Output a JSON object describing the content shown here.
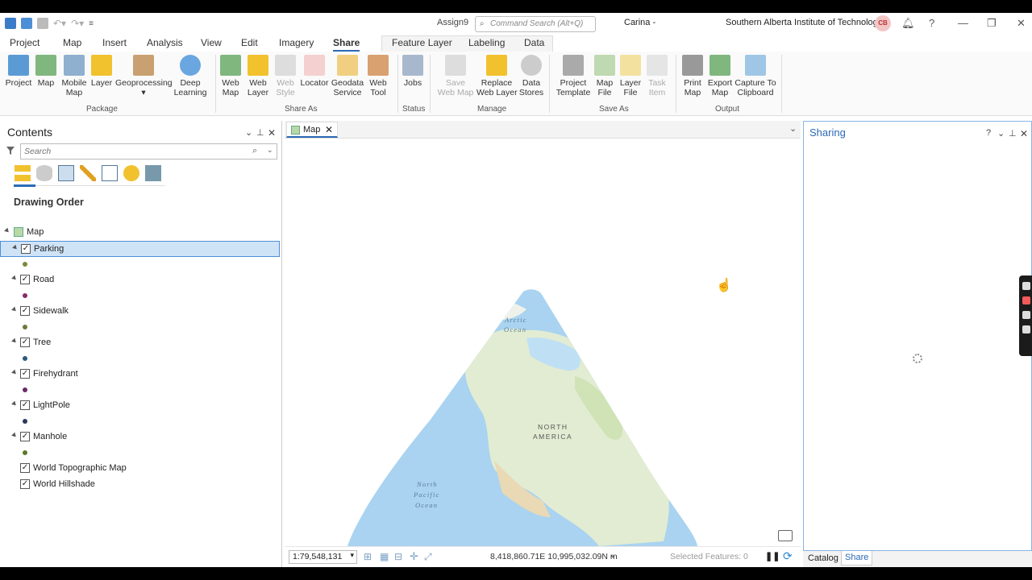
{
  "titlebar": {
    "project": "Assign9",
    "command_search_placeholder": "Command Search (Alt+Q)",
    "app_user": "Carina -",
    "organization": "Southern Alberta Institute of Technology",
    "avatar_initials": "CB"
  },
  "ribbon_tabs": [
    "Project",
    "Map",
    "Insert",
    "Analysis",
    "View",
    "Edit",
    "Imagery",
    "Share",
    "Feature Layer",
    "Labeling",
    "Data"
  ],
  "ribbon": {
    "package": [
      "Project",
      "Map",
      "Mobile\nMap",
      "Layer",
      "Geoprocessing",
      "Deep\nLearning"
    ],
    "package_label": "Package",
    "share_as": [
      "Web\nMap",
      "Web\nLayer",
      "Web\nStyle",
      "Locator",
      "Geodata\nService",
      "Web\nTool"
    ],
    "share_as_label": "Share As",
    "status": [
      "Jobs"
    ],
    "status_label": "Status",
    "manage": [
      "Save\nWeb Map",
      "Replace\nWeb Layer",
      "Data\nStores"
    ],
    "manage_label": "Manage",
    "save_as": [
      "Project\nTemplate",
      "Map\nFile",
      "Layer\nFile",
      "Task\nItem"
    ],
    "save_as_label": "Save As",
    "output": [
      "Print\nMap",
      "Export\nMap",
      "Capture To\nClipboard"
    ],
    "output_label": "Output"
  },
  "contents": {
    "title": "Contents",
    "search_placeholder": "Search",
    "drawing_order": "Drawing Order",
    "map_name": "Map",
    "layers": [
      {
        "name": "Parking",
        "color": "#7a8a3a",
        "selected": true
      },
      {
        "name": "Road",
        "color": "#8a2a6a"
      },
      {
        "name": "Sidewalk",
        "color": "#6a7a3a"
      },
      {
        "name": "Tree",
        "color": "#2a5a7a"
      },
      {
        "name": "Firehydrant",
        "color": "#6a2a6a"
      },
      {
        "name": "LightPole",
        "color": "#2a3a5a"
      },
      {
        "name": "Manhole",
        "color": "#5a7a2a"
      }
    ],
    "basemaps": [
      "World Topographic Map",
      "World Hillshade"
    ]
  },
  "map": {
    "tab": "Map",
    "labels": {
      "arctic": "Arctic\nOcean",
      "na": "NORTH\nAMERICA",
      "pacific": "North\nPacific\nOcean"
    },
    "scale": "1:79,548,131",
    "coordinates": "8,418,860.71E 10,995,032.09N m",
    "selected_features": "Selected Features: 0"
  },
  "sharing": {
    "title": "Sharing",
    "tabs": [
      "Catalog",
      "Share"
    ]
  }
}
